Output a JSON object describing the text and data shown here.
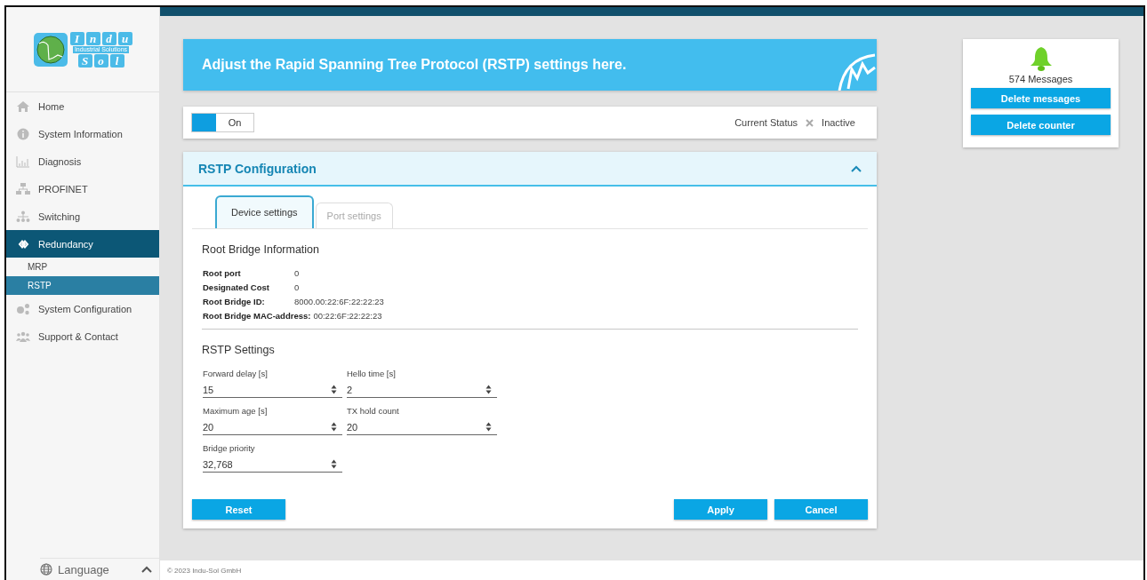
{
  "logo": {
    "letters_top": [
      "I",
      "n",
      "d",
      "u"
    ],
    "tagline": "Industrial Solutions",
    "letters_bottom": [
      "S",
      "o",
      "l"
    ]
  },
  "sidebar": {
    "items": [
      {
        "label": "Home",
        "selected": false
      },
      {
        "label": "System Information",
        "selected": false
      },
      {
        "label": "Diagnosis",
        "selected": false
      },
      {
        "label": "PROFINET",
        "selected": false
      },
      {
        "label": "Switching",
        "selected": false
      },
      {
        "label": "Redundancy",
        "selected": true,
        "children": [
          {
            "label": "MRP",
            "selected": false
          },
          {
            "label": "RSTP",
            "selected": true
          }
        ]
      },
      {
        "label": "System Configuration",
        "selected": false
      },
      {
        "label": "Support & Contact",
        "selected": false
      }
    ]
  },
  "language": {
    "label": "Language"
  },
  "footer": "© 2023 Indu-Sol GmbH",
  "banner": {
    "title": "Adjust the Rapid Spanning Tree Protocol (RSTP) settings here."
  },
  "toggle": {
    "label": "On",
    "on": true
  },
  "status": {
    "label": "Current Status",
    "active": false,
    "value": "Inactive"
  },
  "panel": {
    "title": "RSTP Configuration",
    "expanded": true,
    "tabs": [
      {
        "label": "Device settings",
        "selected": true
      },
      {
        "label": "Port settings",
        "selected": false
      }
    ],
    "root_info": {
      "heading": "Root Bridge Information",
      "rows": [
        {
          "label": "Root port",
          "value": "0"
        },
        {
          "label": "Designated Cost",
          "value": "0"
        },
        {
          "label": "Root Bridge ID:",
          "value": "8000.00:22:6F:22:22:23"
        },
        {
          "label": "Root Bridge MAC-address:",
          "value": "00:22:6F:22:22:23"
        }
      ]
    },
    "settings": {
      "heading": "RSTP Settings",
      "fields": [
        {
          "label": "Forward delay [s]",
          "value": "15"
        },
        {
          "label": "Hello time [s]",
          "value": "2"
        },
        {
          "label": "Maximum age [s]",
          "value": "20"
        },
        {
          "label": "TX hold count",
          "value": "20"
        },
        {
          "label": "Bridge priority",
          "value": "32,768"
        }
      ]
    },
    "left_buttons": [
      "Reset"
    ],
    "right_buttons": [
      "Apply",
      "Cancel"
    ]
  },
  "notifications": {
    "count_text": "574 Messages",
    "buttons": [
      "Delete messages",
      "Delete counter"
    ]
  }
}
